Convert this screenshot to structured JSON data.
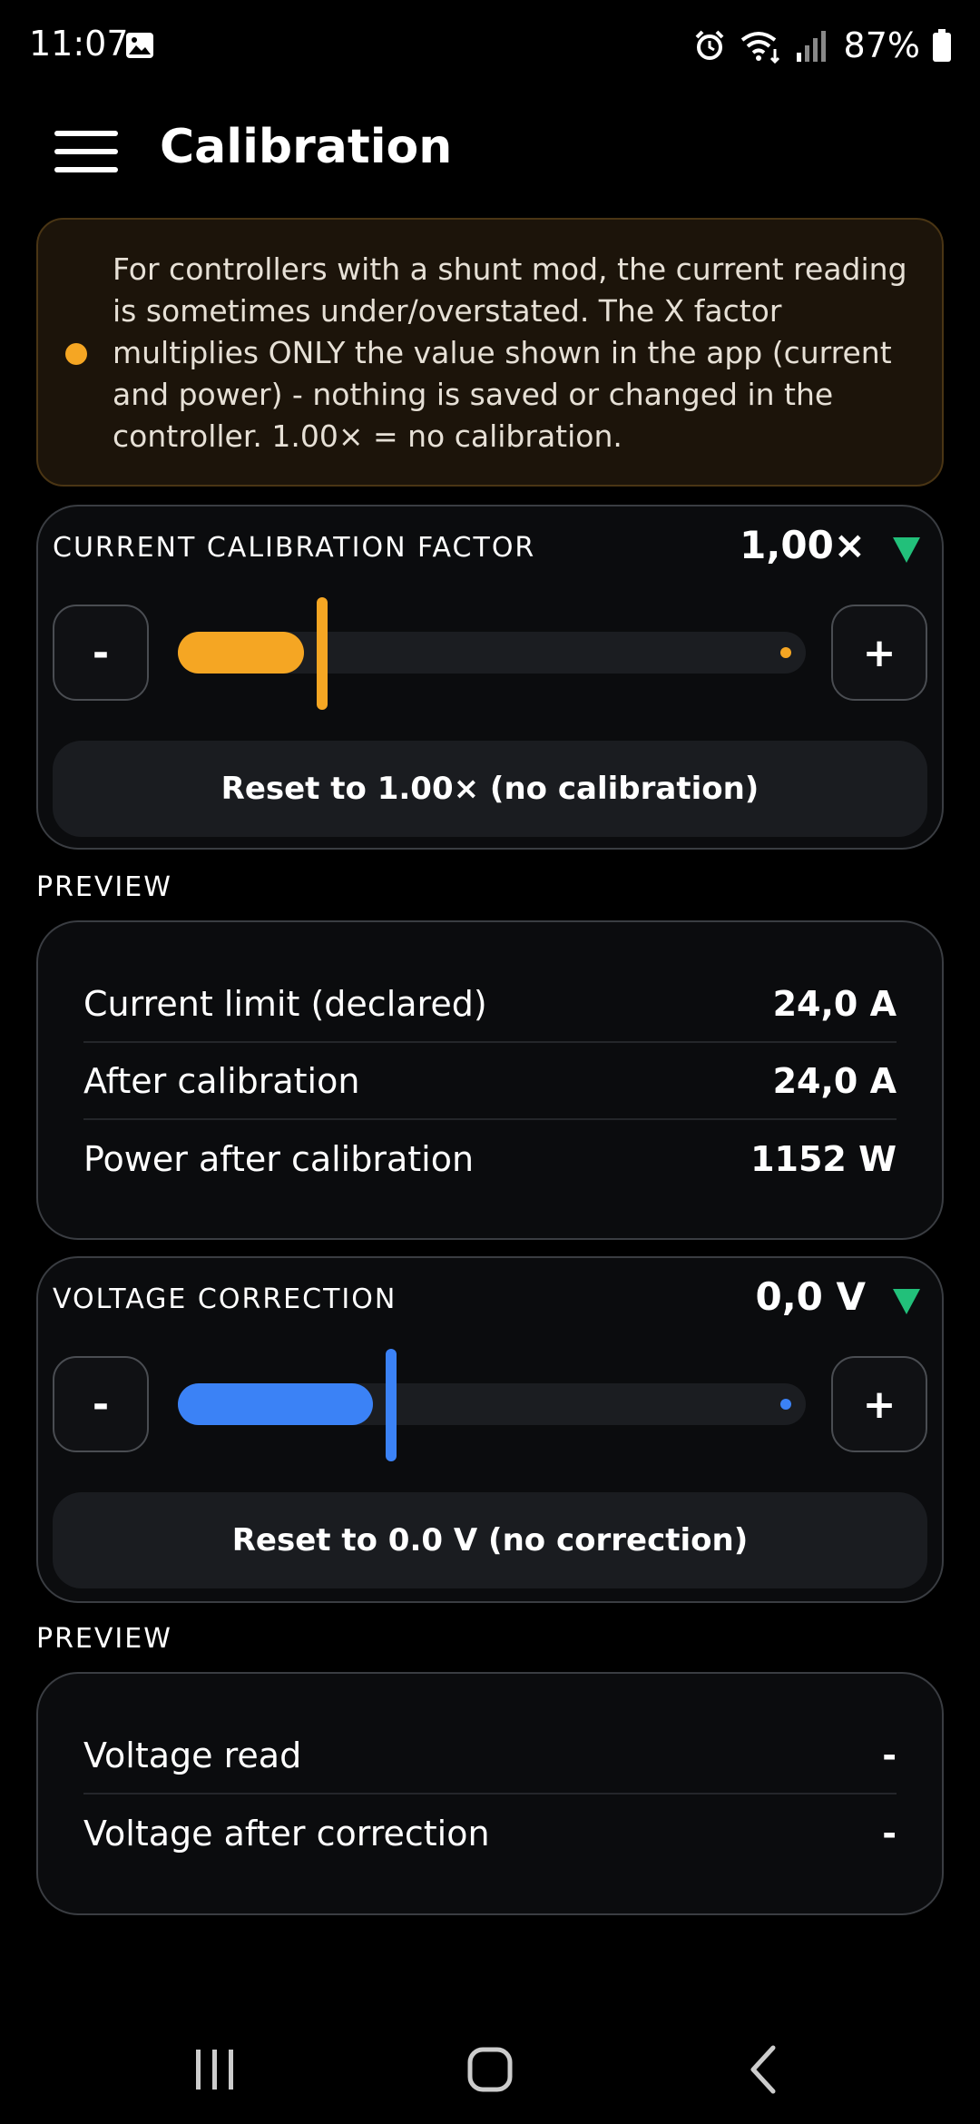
{
  "status_bar": {
    "time": "11:07",
    "battery": "87%"
  },
  "app_bar": {
    "title": "Calibration"
  },
  "info": {
    "text": "For controllers with a shunt mod, the current reading is sometimes under/overstated. The X factor multiplies ONLY the value shown in the app (current and power) - nothing is saved or changed in the controller. 1.00× = no calibration."
  },
  "current_calibration": {
    "label": "CURRENT CALIBRATION FACTOR",
    "value": "1,00×",
    "minus_label": "-",
    "plus_label": "+",
    "slider_fraction": 0.23,
    "reset_label": "Reset to 1.00× (no calibration)"
  },
  "current_preview": {
    "label": "PREVIEW",
    "rows": [
      {
        "label": "Current limit (declared)",
        "value": "24,0 A"
      },
      {
        "label": "After calibration",
        "value": "24,0 A"
      },
      {
        "label": "Power after calibration",
        "value": "1152 W"
      }
    ]
  },
  "voltage_correction": {
    "label": "VOLTAGE CORRECTION",
    "value": "0,0 V",
    "minus_label": "-",
    "plus_label": "+",
    "slider_fraction": 0.34,
    "reset_label": "Reset to 0.0 V (no correction)"
  },
  "voltage_preview": {
    "label": "PREVIEW",
    "rows": [
      {
        "label": "Voltage read",
        "value": "-"
      },
      {
        "label": "Voltage after correction",
        "value": "-"
      }
    ]
  },
  "colors": {
    "accent_orange": "#f5a623",
    "accent_blue": "#3b82f6",
    "trend_green": "#22c07a"
  }
}
